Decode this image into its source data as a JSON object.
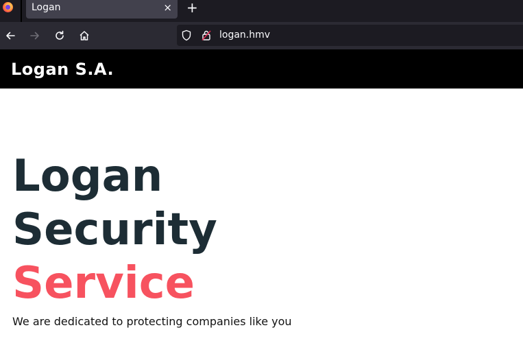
{
  "browser": {
    "tab_title": "Logan",
    "tab_close": "×",
    "new_tab": "+",
    "url": "logan.hmv"
  },
  "header": {
    "brand": "Logan S.A."
  },
  "hero": {
    "line1": "Logan",
    "line2": "Security",
    "line3": "Service",
    "tagline": "We are dedicated to protecting companies like you"
  },
  "colors": {
    "heading": "#1d2d35",
    "accent": "#f7525f",
    "header_bg": "#000000"
  }
}
